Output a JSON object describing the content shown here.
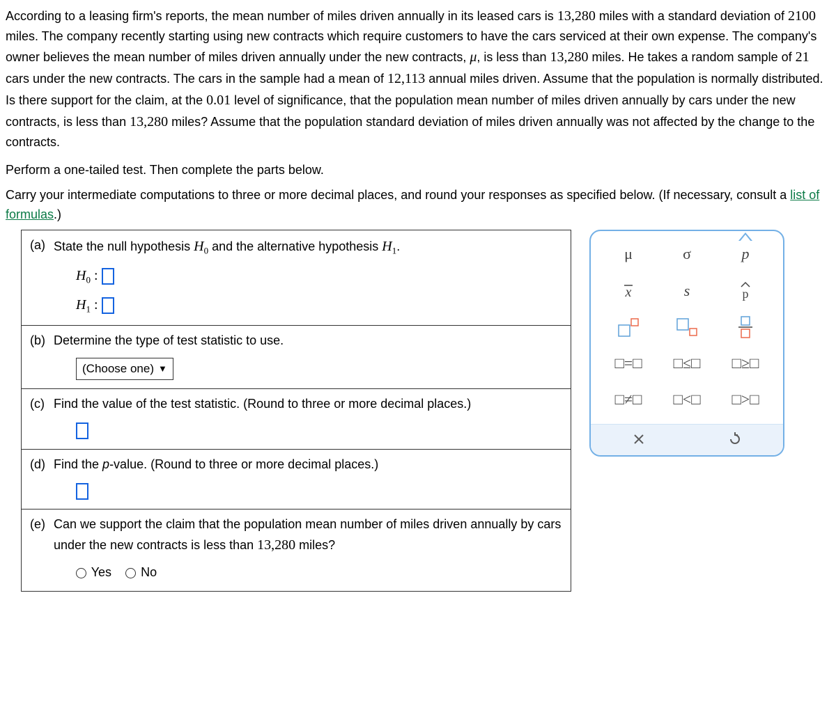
{
  "problem": {
    "text_before_num1": "According to a leasing firm's reports, the mean number of miles driven annually in its leased cars is ",
    "num1": "13,280",
    "text_after_num1": " miles with a standard deviation of ",
    "num2": "2100",
    "text_after_num2": " miles. The company recently starting using new contracts which require customers to have the cars serviced at their own expense. The company's owner believes the mean number of miles driven annually under the new contracts, ",
    "mu": "μ",
    "text_after_mu": ", is less than ",
    "num3": "13,280",
    "text_after_num3": " miles. He takes a random sample of ",
    "num4": "21",
    "text_after_num4": " cars under the new contracts. The cars in the sample had a mean of ",
    "num5": "12,113",
    "text_after_num5": " annual miles driven. Assume that the population is normally distributed. Is there support for the claim, at the ",
    "num6": "0.01",
    "text_after_num6": " level of significance, that the population mean number of miles driven annually by cars under the new contracts, is less than ",
    "num7": "13,280",
    "text_after_num7": " miles? Assume that the population standard deviation of miles driven annually was not affected by the change to the contracts."
  },
  "instruction1": "Perform a one-tailed test. Then complete the parts below.",
  "instruction2_before": "Carry your intermediate computations to three or more decimal places, and round your responses as specified below. (If necessary, consult a ",
  "instruction2_link": "list of formulas",
  "instruction2_after": ".)",
  "parts": {
    "a": {
      "label": "(a)",
      "text_before": "State the null hypothesis ",
      "h0": "H",
      "h0_sub": "0",
      "text_mid": " and the alternative hypothesis ",
      "h1": "H",
      "h1_sub": "1",
      "text_after": ".",
      "line1_h": "H",
      "line1_sub": "0",
      "colon": " :",
      "line2_h": "H",
      "line2_sub": "1"
    },
    "b": {
      "label": "(b)",
      "text": "Determine the type of test statistic to use.",
      "dropdown": "(Choose one)"
    },
    "c": {
      "label": "(c)",
      "text": "Find the value of the test statistic. (Round to three or more decimal places.)"
    },
    "d": {
      "label": "(d)",
      "text_before": "Find the ",
      "pval": "p",
      "text_after": "-value. (Round to three or more decimal places.)"
    },
    "e": {
      "label": "(e)",
      "text_before": "Can we support the claim that the population mean number of miles driven annually by cars under the new contracts is less than ",
      "num": "13,280",
      "text_after": " miles?",
      "yes": "Yes",
      "no": "No"
    }
  },
  "palette": {
    "mu": "μ",
    "sigma": "σ",
    "p": "p",
    "xbar": "x̄",
    "s": "s",
    "phat": "p̂",
    "eq": "□=□",
    "le": "□≤□",
    "ge": "□≥□",
    "ne": "□≠□",
    "lt": "□<□",
    "gt": "□>□",
    "clear": "×",
    "undo": "↺"
  }
}
